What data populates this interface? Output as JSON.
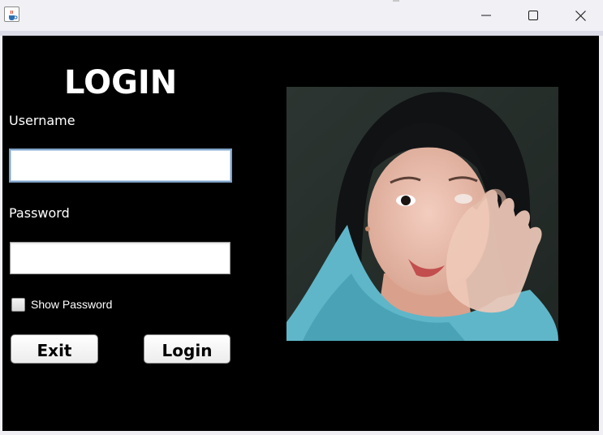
{
  "window": {
    "minimize_glyph": "—",
    "maximize_glyph": "☐",
    "close_glyph": "✕"
  },
  "form": {
    "title": "LOGIN",
    "username_label": "Username",
    "username_value": "",
    "password_label": "Password",
    "password_value": "",
    "show_password_label": "Show Password",
    "show_password_checked": false,
    "exit_label": "Exit",
    "login_label": "Login"
  },
  "icons": {
    "app": "java-cup-icon",
    "minimize": "minimize-icon",
    "maximize": "maximize-icon",
    "close": "close-icon"
  },
  "colors": {
    "background": "#000000",
    "text": "#ffffff",
    "titlebar": "#f0f0f5",
    "focused_field_border": "#7fa3c8"
  }
}
